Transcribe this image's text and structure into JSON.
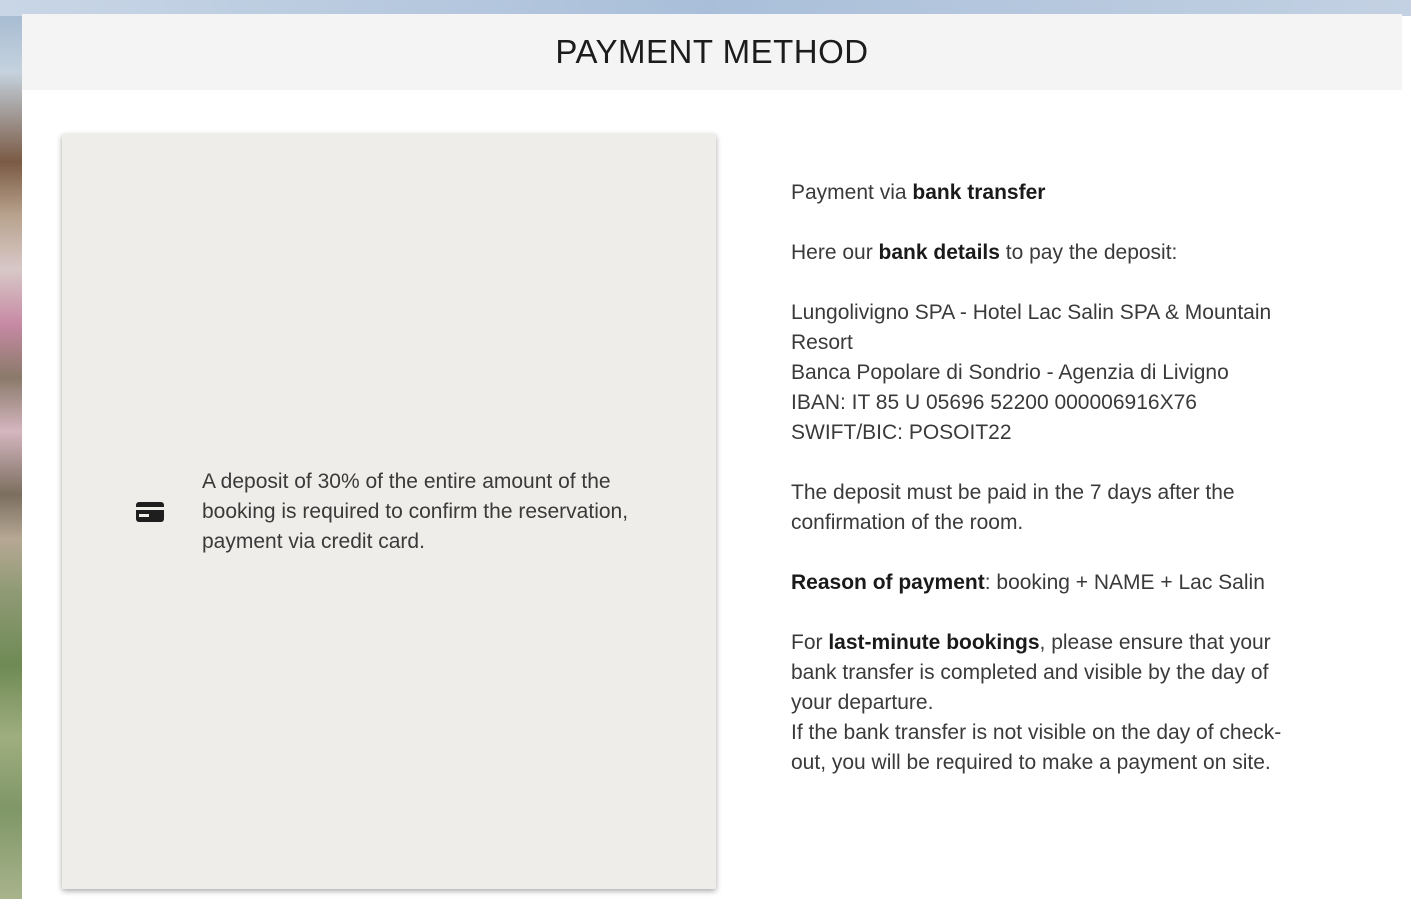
{
  "header": {
    "title": "PAYMENT METHOD"
  },
  "card": {
    "icon": "credit-card-icon",
    "text": "A deposit of 30% of the entire amount of the booking is required to confirm the reservation, payment via credit card."
  },
  "bank_transfer": {
    "intro_prefix": "Payment via ",
    "intro_bold": "bank transfer",
    "details_prefix": "Here our ",
    "details_bold": "bank details",
    "details_suffix": " to pay the deposit:",
    "account_name": "Lungolivigno SPA - Hotel Lac Salin SPA & Mountain Resort",
    "bank_name": "Banca Popolare di Sondrio - Agenzia di Livigno",
    "iban": "IBAN: IT 85 U 05696 52200 000006916X76",
    "swift": "SWIFT/BIC: POSOIT22",
    "deadline": "The deposit must be paid in the 7 days after the confirmation of the room.",
    "reason_bold": "Reason of payment",
    "reason_text": ": booking + NAME + Lac Salin",
    "lastminute_prefix": "For ",
    "lastminute_bold": "last-minute bookings",
    "lastminute_text": ", please ensure that your bank transfer is completed and visible by the day of your departure.",
    "checkout_text": "If the bank transfer is not visible on the day of check-out, you will be required to make a payment on site."
  },
  "colors": {
    "card_background": "#efedea",
    "header_background": "#f4f4f4"
  }
}
